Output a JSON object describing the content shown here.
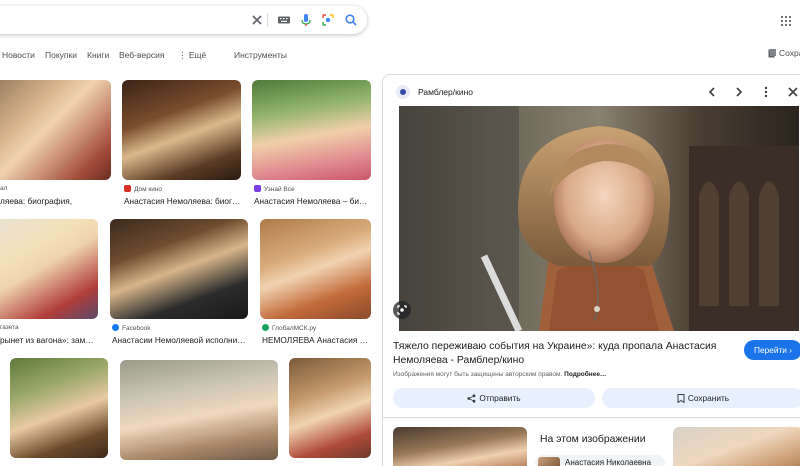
{
  "search": {
    "icons": [
      "close-icon",
      "keyboard-icon",
      "mic-icon",
      "lens-icon",
      "search-icon"
    ]
  },
  "tabs": {
    "news": "Новости",
    "shopping": "Покупки",
    "books": "Книги",
    "web": "Веб-версия",
    "more": "⋮ Ещё",
    "tools": "Инструменты"
  },
  "save_top": "Сохра",
  "results": [
    {
      "source": "ал",
      "title": "ляева: биография,"
    },
    {
      "source": "Дом кино",
      "title": "Анастасия Немоляева: биог…"
    },
    {
      "source": "Узнай Все",
      "title": "Анастасия Немоляева – би…"
    },
    {
      "source": "газета",
      "title": "рынет из вагона»: зам…"
    },
    {
      "source": "Facebook",
      "title": "Анастасии Немоляевой исполнил…"
    },
    {
      "source": "ГлобалМСК.ру",
      "title": "НЕМОЛЯЕВА Анастасия …"
    }
  ],
  "panel": {
    "site": "Рамблер/кино",
    "title": "Тяжело переживаю события на Украине»: куда пропала Анастасия Немоляева - Рамблер/кино",
    "copyright_prefix": "Изображения могут быть защищены авторским правом.",
    "copyright_link": "Подробнее…",
    "visit": "Перейти",
    "share": "Отправить",
    "save": "Сохранить",
    "on_this_image": "На этом изображении",
    "person": "Анастасия Николаевна"
  },
  "colors": {
    "accent": "#1a73e8",
    "button_soft": "#e8f0fe",
    "text": "#202124",
    "muted": "#4d5156"
  }
}
